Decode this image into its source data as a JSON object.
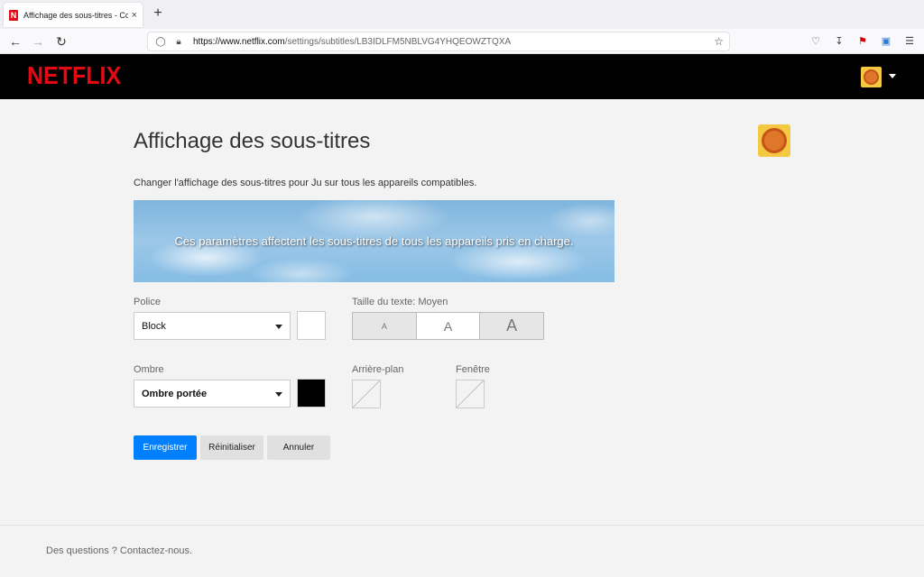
{
  "browser": {
    "tab_title": "Affichage des sous-titres - Cor",
    "favicon_letter": "N",
    "new_tab": "+",
    "close": "×",
    "url_domain": "https://www.netflix.com",
    "url_path": "/settings/subtitles/LB3IDLFM5NBLVG4YHQEOWZTQXA"
  },
  "header": {
    "logo": "NETFLIX"
  },
  "page": {
    "title": "Affichage des sous-titres",
    "description": "Changer l'affichage des sous-titres pour Ju sur tous les appareils compatibles.",
    "preview_text": "Ces paramètres affectent les sous-titres de tous les appareils pris en charge."
  },
  "font": {
    "label": "Police",
    "value": "Block",
    "color": "#ffffff"
  },
  "text_size": {
    "label": "Taille du texte: Moyen",
    "options": [
      "A",
      "A",
      "A"
    ],
    "selected_index": 1
  },
  "shadow": {
    "label": "Ombre",
    "value": "Ombre portée",
    "color": "#000000"
  },
  "background": {
    "label": "Arrière-plan"
  },
  "window": {
    "label": "Fenêtre"
  },
  "actions": {
    "save": "Enregistrer",
    "reset": "Réinitialiser",
    "cancel": "Annuler"
  },
  "footer": {
    "contact": "Des questions ? Contactez-nous."
  },
  "colors": {
    "netflix_red": "#e50914",
    "primary_button": "#0080ff"
  }
}
